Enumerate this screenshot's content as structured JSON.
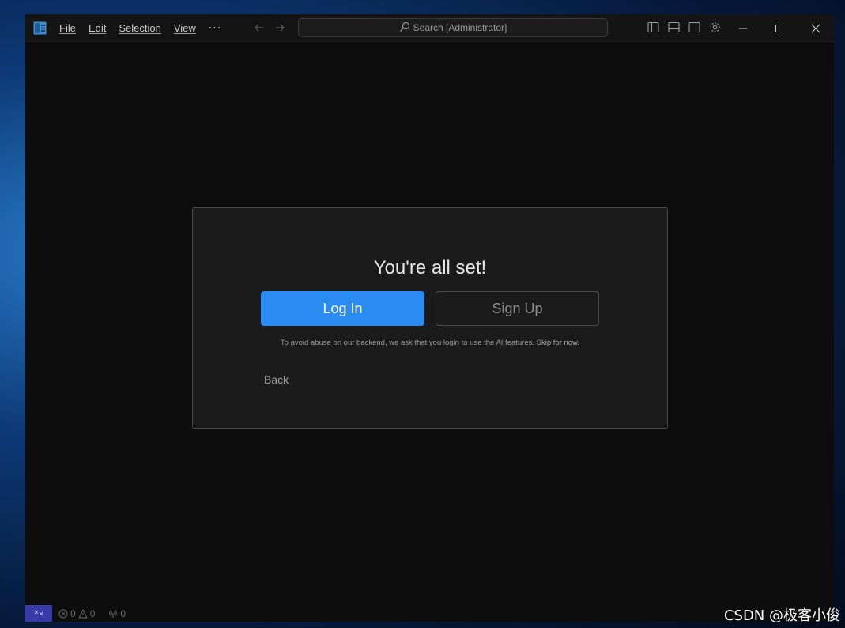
{
  "menu": {
    "items": [
      "File",
      "Edit",
      "Selection",
      "View"
    ],
    "more": "···"
  },
  "search": {
    "label": "Search [Administrator]"
  },
  "dialog": {
    "title": "You're all set!",
    "login_label": "Log In",
    "signup_label": "Sign Up",
    "notice": "To avoid abuse on our backend, we ask that you login to use the AI features.",
    "skip_label": "Skip for now.",
    "back_label": "Back"
  },
  "status": {
    "errors": "0",
    "warnings": "0",
    "ports": "0"
  },
  "watermark": "CSDN @极客小俊",
  "colors": {
    "accent": "#2a8bf0",
    "remote": "#3a3aa8",
    "editor_bg": "#0d0d0d",
    "dialog_bg": "#1b1b1b"
  },
  "icons": [
    "app-logo-icon",
    "arrow-left-icon",
    "arrow-right-icon",
    "search-icon",
    "toggle-primary-sidebar-icon",
    "toggle-panel-icon",
    "toggle-secondary-sidebar-icon",
    "gear-icon",
    "minimize-icon",
    "maximize-icon",
    "close-icon",
    "remote-icon",
    "error-icon",
    "warning-icon",
    "ports-icon"
  ]
}
